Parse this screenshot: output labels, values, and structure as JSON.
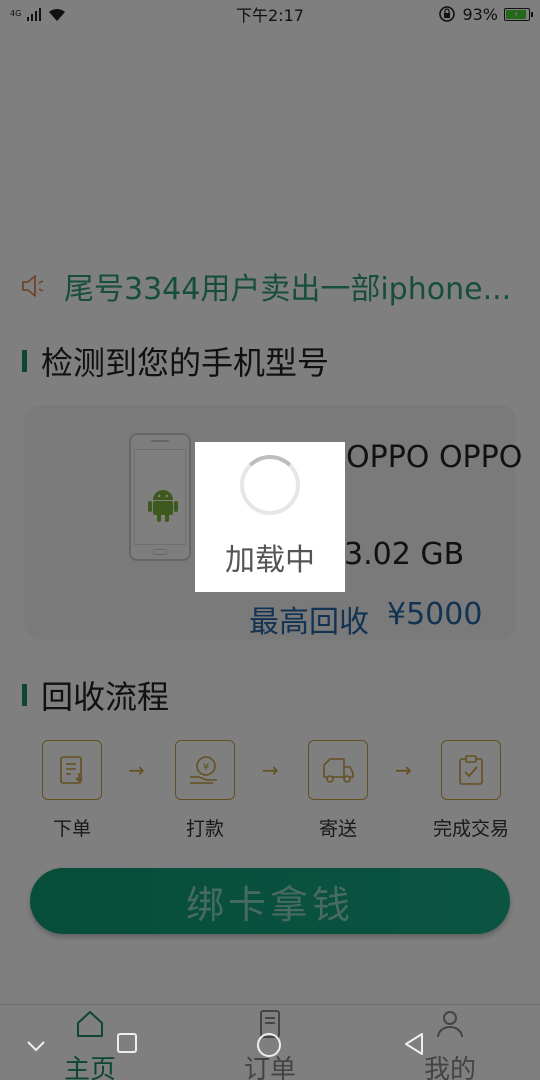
{
  "status_bar": {
    "network": "4G",
    "time": "下午2:17",
    "battery": "93%"
  },
  "marquee": {
    "text": "尾号3344用户卖出一部iphone..."
  },
  "detect_section": {
    "title": "检测到您的手机型号"
  },
  "phone_card": {
    "model": "OPPO OPPO",
    "storage": "3.02 GB",
    "price_label": "最高回收",
    "price_value": "¥5000"
  },
  "loading": {
    "text": "加载中"
  },
  "flow_section": {
    "title": "回收流程",
    "steps": [
      {
        "label": "下单",
        "icon": "order-form-icon"
      },
      {
        "label": "打款",
        "icon": "payment-icon"
      },
      {
        "label": "寄送",
        "icon": "delivery-truck-icon"
      },
      {
        "label": "完成交易",
        "icon": "clipboard-check-icon"
      }
    ],
    "arrow": "→"
  },
  "cta": {
    "label": "绑卡拿钱"
  },
  "tab_bar": {
    "items": [
      {
        "label": "主页",
        "icon": "home-icon"
      },
      {
        "label": "订单",
        "icon": "orders-icon"
      },
      {
        "label": "我的",
        "icon": "person-icon"
      }
    ]
  },
  "colors": {
    "brand_green": "#1e8a6a",
    "gold": "#c8a042",
    "price_blue": "#2666a6"
  }
}
